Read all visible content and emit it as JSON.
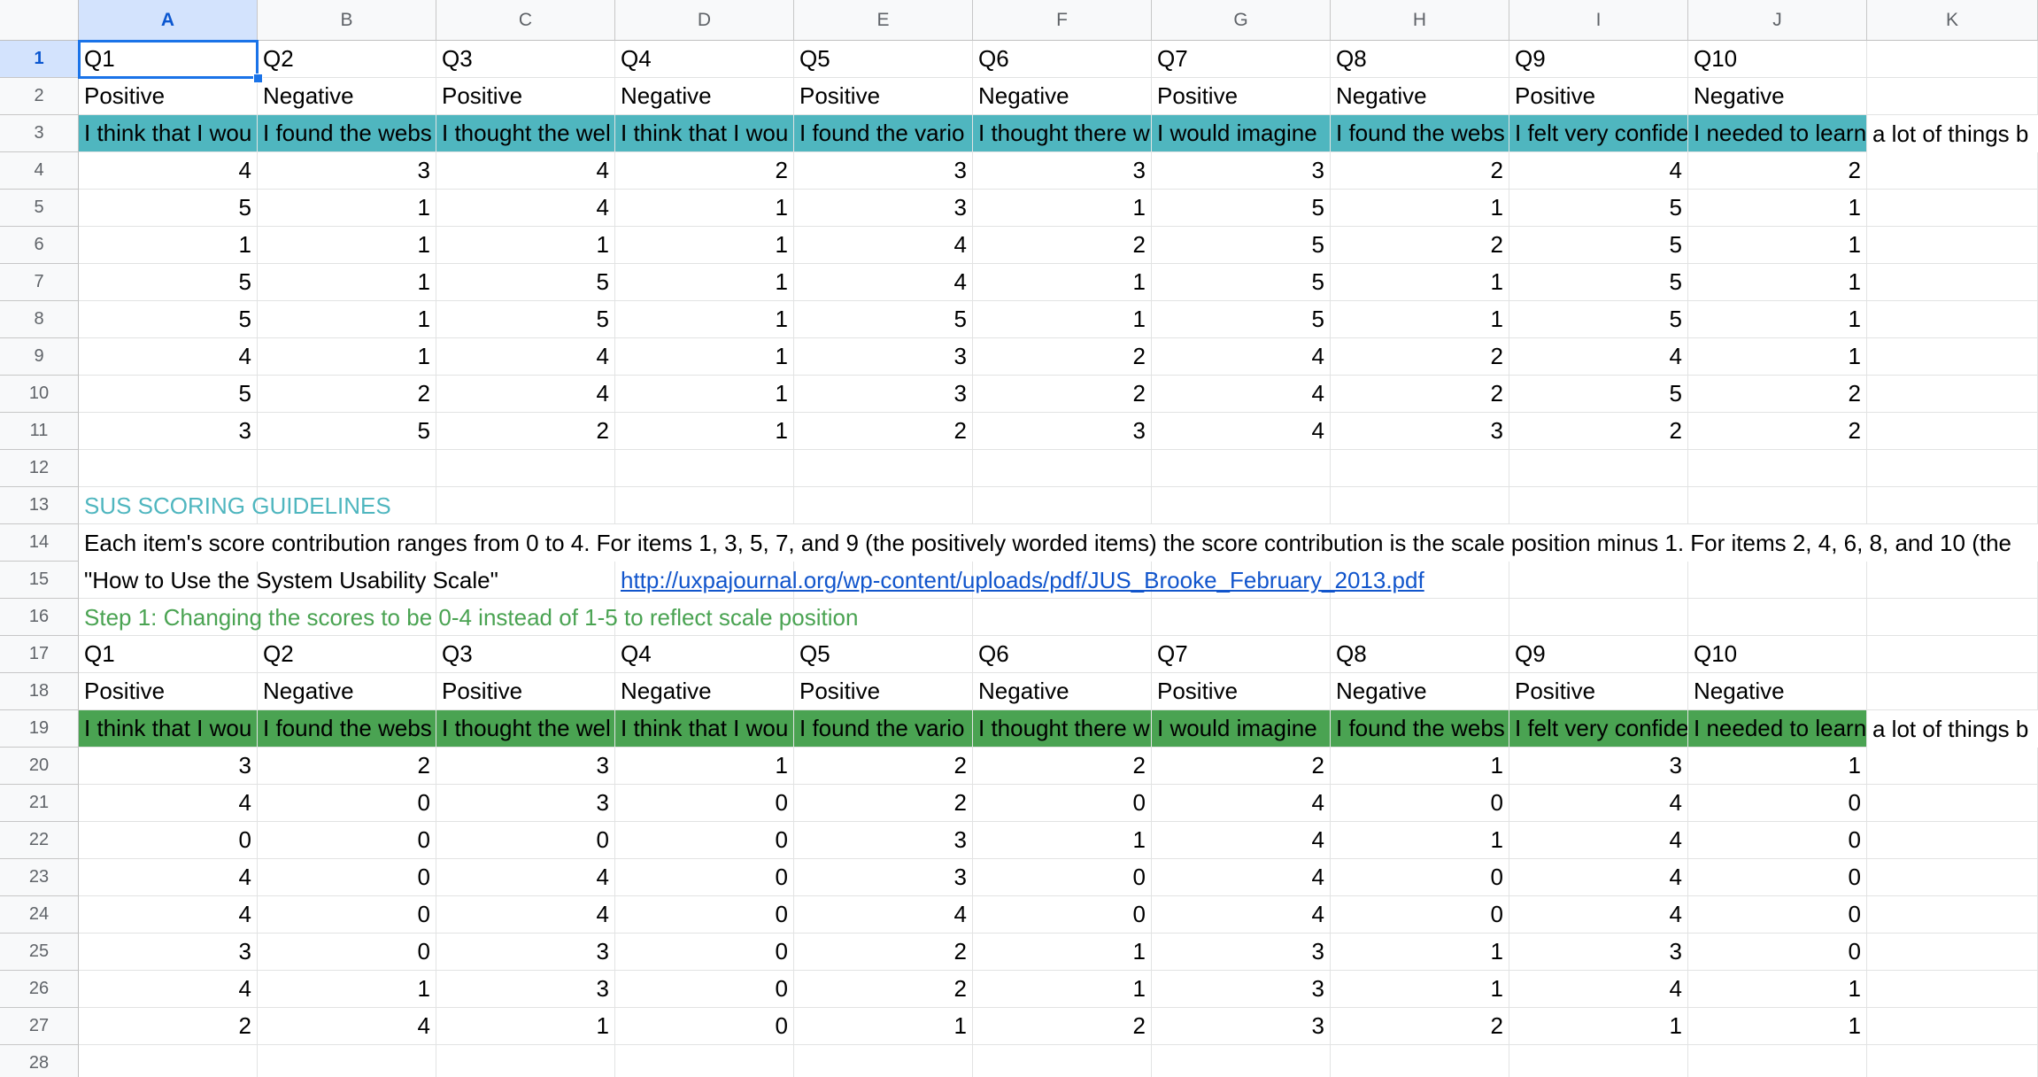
{
  "columns": [
    "A",
    "B",
    "C",
    "D",
    "E",
    "F",
    "G",
    "H",
    "I",
    "J",
    "K"
  ],
  "rows": [
    "1",
    "2",
    "3",
    "4",
    "5",
    "6",
    "7",
    "8",
    "9",
    "10",
    "11",
    "12",
    "13",
    "14",
    "15",
    "16",
    "17",
    "18",
    "19",
    "20",
    "21",
    "22",
    "23",
    "24",
    "25",
    "26",
    "27",
    "28"
  ],
  "colors": {
    "teal": "#4fb6bf",
    "green": "#4aa352",
    "link": "#1155cc",
    "selection": "#1a73e8"
  },
  "table1": {
    "questions": [
      "Q1",
      "Q2",
      "Q3",
      "Q4",
      "Q5",
      "Q6",
      "Q7",
      "Q8",
      "Q9",
      "Q10"
    ],
    "polarity": [
      "Positive",
      "Negative",
      "Positive",
      "Negative",
      "Positive",
      "Negative",
      "Positive",
      "Negative",
      "Positive",
      "Negative"
    ],
    "statements": [
      "I think that I wou",
      "I found the webs",
      "I thought the wel",
      "I think that I wou",
      "I found the vario",
      "I thought there w",
      "I would imagine ",
      "I found the webs",
      "I felt very confide",
      "I needed to learn"
    ],
    "statement_overflow": "a lot of things b",
    "values": [
      [
        4,
        3,
        4,
        2,
        3,
        3,
        3,
        2,
        4,
        2
      ],
      [
        5,
        1,
        4,
        1,
        3,
        1,
        5,
        1,
        5,
        1
      ],
      [
        1,
        1,
        1,
        1,
        4,
        2,
        5,
        2,
        5,
        1
      ],
      [
        5,
        1,
        5,
        1,
        4,
        1,
        5,
        1,
        5,
        1
      ],
      [
        5,
        1,
        5,
        1,
        5,
        1,
        5,
        1,
        5,
        1
      ],
      [
        4,
        1,
        4,
        1,
        3,
        2,
        4,
        2,
        4,
        1
      ],
      [
        5,
        2,
        4,
        1,
        3,
        2,
        4,
        2,
        5,
        2
      ],
      [
        3,
        5,
        2,
        1,
        2,
        3,
        4,
        3,
        2,
        2
      ]
    ]
  },
  "guidelines": {
    "title": "SUS SCORING GUIDELINES",
    "description": "Each item's score contribution ranges from 0 to 4. For items 1, 3, 5, 7, and 9 (the positively worded items) the score contribution is the scale position minus 1. For items 2, 4, 6, 8, and 10 (the",
    "reference_label": "\"How to Use the System Usability Scale\"",
    "reference_link": "http://uxpajournal.org/wp-content/uploads/pdf/JUS_Brooke_February_2013.pdf",
    "step1": "Step 1: Changing the scores to be 0-4 instead of 1-5 to reflect scale position"
  },
  "table2": {
    "questions": [
      "Q1",
      "Q2",
      "Q3",
      "Q4",
      "Q5",
      "Q6",
      "Q7",
      "Q8",
      "Q9",
      "Q10"
    ],
    "polarity": [
      "Positive",
      "Negative",
      "Positive",
      "Negative",
      "Positive",
      "Negative",
      "Positive",
      "Negative",
      "Positive",
      "Negative"
    ],
    "statements": [
      "I think that I wou",
      "I found the webs",
      "I thought the wel",
      "I think that I wou",
      "I found the vario",
      "I thought there w",
      "I would imagine ",
      "I found the webs",
      "I felt very confide",
      "I needed to learn"
    ],
    "statement_overflow": "a lot of things b",
    "values": [
      [
        3,
        2,
        3,
        1,
        2,
        2,
        2,
        1,
        3,
        1
      ],
      [
        4,
        0,
        3,
        0,
        2,
        0,
        4,
        0,
        4,
        0
      ],
      [
        0,
        0,
        0,
        0,
        3,
        1,
        4,
        1,
        4,
        0
      ],
      [
        4,
        0,
        4,
        0,
        3,
        0,
        4,
        0,
        4,
        0
      ],
      [
        4,
        0,
        4,
        0,
        4,
        0,
        4,
        0,
        4,
        0
      ],
      [
        3,
        0,
        3,
        0,
        2,
        1,
        3,
        1,
        3,
        0
      ],
      [
        4,
        1,
        3,
        0,
        2,
        1,
        3,
        1,
        4,
        1
      ],
      [
        2,
        4,
        1,
        0,
        1,
        2,
        3,
        2,
        1,
        1
      ]
    ]
  }
}
